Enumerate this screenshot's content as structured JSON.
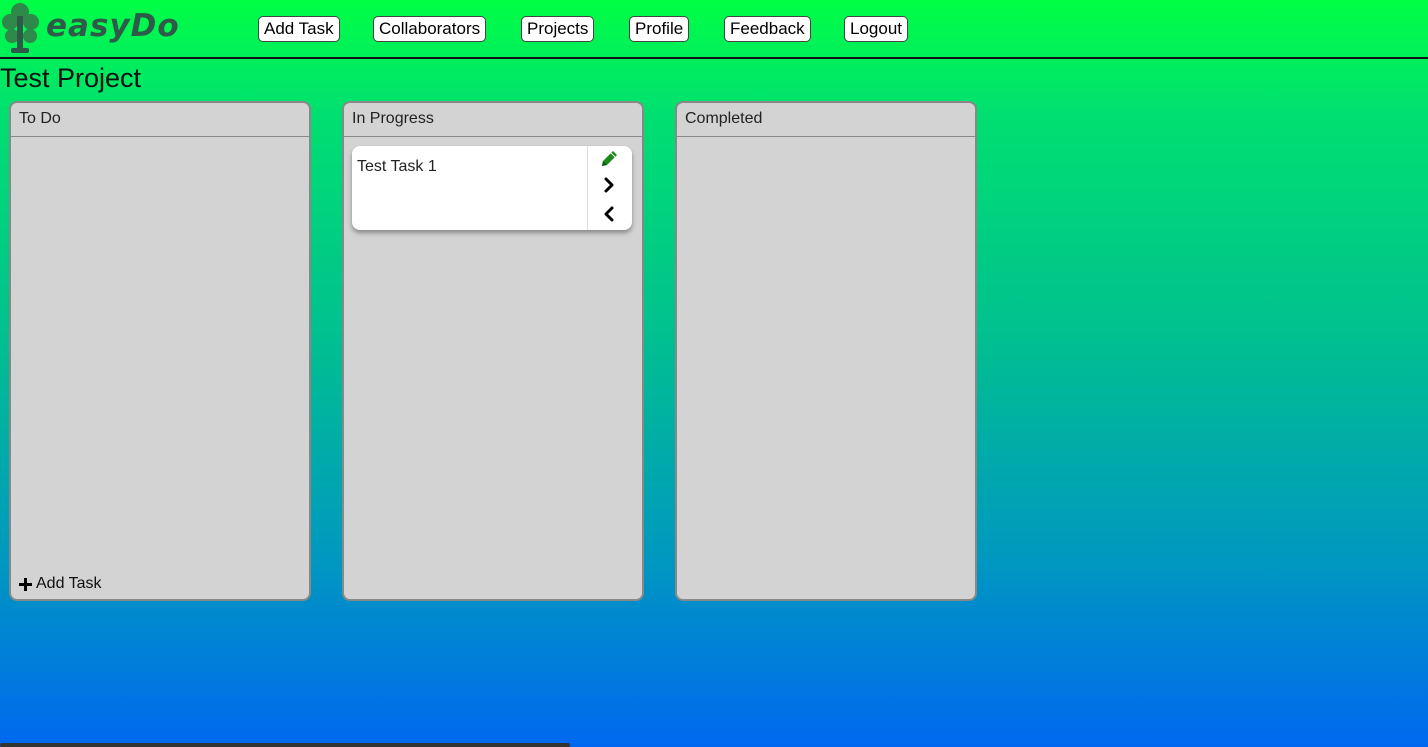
{
  "app": {
    "logo_text": "easyDo"
  },
  "nav": {
    "items": [
      {
        "label": "Add Task"
      },
      {
        "label": "Collaborators"
      },
      {
        "label": "Projects"
      },
      {
        "label": "Profile"
      },
      {
        "label": "Feedback"
      },
      {
        "label": "Logout"
      }
    ]
  },
  "project": {
    "title": "Test Project"
  },
  "board": {
    "columns": [
      {
        "title": "To Do",
        "add_label": "Add Task",
        "tasks": []
      },
      {
        "title": "In Progress",
        "tasks": [
          {
            "title": "Test Task 1"
          }
        ]
      },
      {
        "title": "Completed",
        "tasks": []
      }
    ]
  },
  "colors": {
    "gradient_top": "#00ff44",
    "gradient_bottom": "#0068f0",
    "column_bg": "#d3d3d3",
    "edit_icon": "#1a8a1a",
    "logo": "#2e5a4a"
  },
  "icons": {
    "logo": "tree-icon",
    "edit": "pencil-icon",
    "next": "chevron-right-icon",
    "prev": "chevron-left-icon",
    "add": "plus-icon"
  }
}
